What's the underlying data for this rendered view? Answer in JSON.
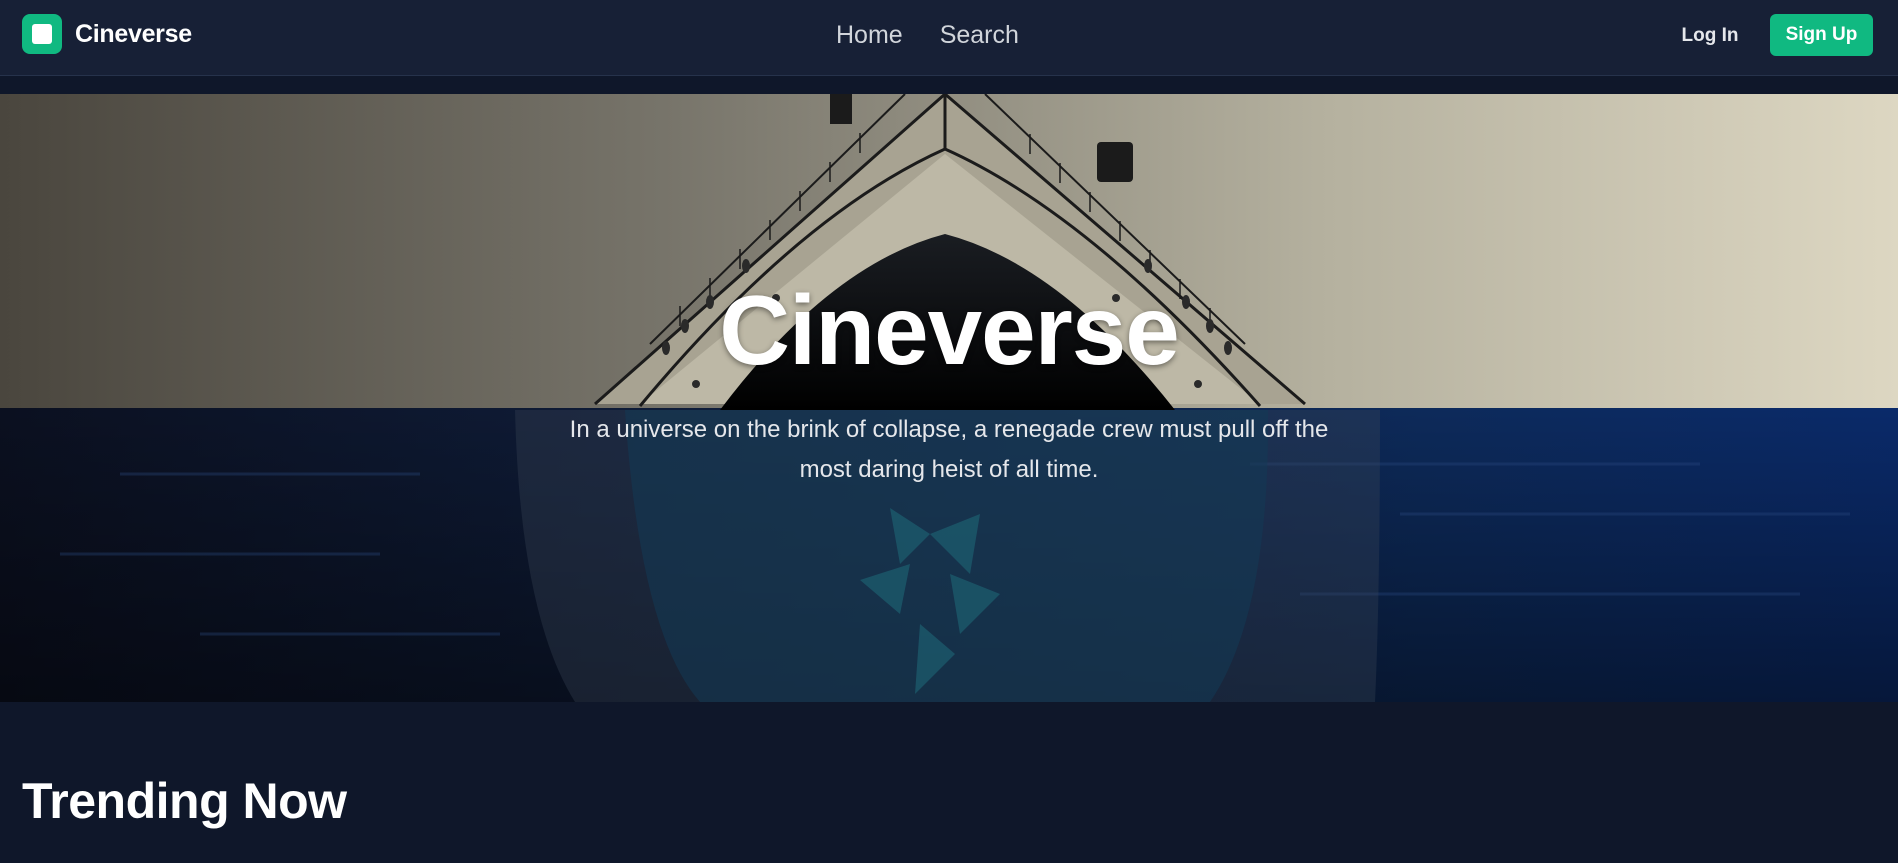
{
  "nav": {
    "brand": "Cineverse",
    "links": [
      "Home",
      "Search"
    ],
    "login": "Log In",
    "signup": "Sign Up"
  },
  "hero": {
    "title": "Cineverse",
    "tagline": "In a universe on the brink of collapse, a renegade crew must pull off the most daring heist of all time."
  },
  "sections": {
    "trending_title": "Trending Now"
  },
  "colors": {
    "nav_bg": "#172036",
    "page_bg": "#0f172a",
    "accent": "#10b981"
  }
}
